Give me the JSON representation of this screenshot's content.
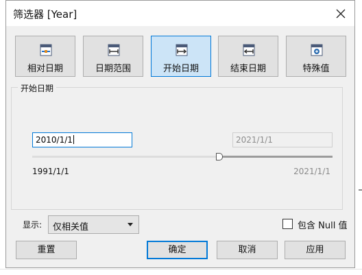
{
  "window": {
    "title": "筛选器 [Year]"
  },
  "modes": [
    {
      "label": "相对日期",
      "icon": "relative-date-icon",
      "active": false
    },
    {
      "label": "日期范围",
      "icon": "date-range-icon",
      "active": false
    },
    {
      "label": "开始日期",
      "icon": "start-date-icon",
      "active": true
    },
    {
      "label": "结束日期",
      "icon": "end-date-icon",
      "active": false
    },
    {
      "label": "特殊值",
      "icon": "special-values-icon",
      "active": false
    }
  ],
  "panel": {
    "title": "开始日期",
    "start_value": "2010/1/1",
    "end_value": "2021/1/1",
    "range_min": "1991/1/1",
    "range_max": "2021/1/1",
    "slider_position": 0.6
  },
  "show": {
    "label": "显示:",
    "selected": "仅相关值"
  },
  "include_null": {
    "label": "包含 Null 值",
    "checked": false
  },
  "buttons": {
    "reset": "重置",
    "ok": "确定",
    "cancel": "取消",
    "apply": "应用"
  },
  "colors": {
    "accent": "#0078d7",
    "active_bg": "#cce4f7",
    "dialog_bg": "#f0f0f0"
  }
}
